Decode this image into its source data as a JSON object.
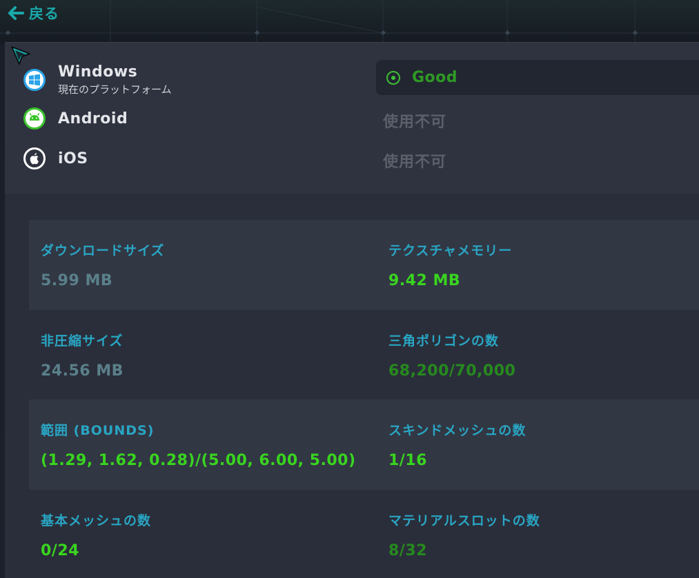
{
  "header": {
    "back_label": "戻る"
  },
  "platforms": [
    {
      "name": "Windows",
      "subtitle": "現在のプラットフォーム",
      "icon": "windows-icon",
      "status": "Good",
      "status_color": "#2f9a25"
    },
    {
      "name": "Android",
      "icon": "android-icon",
      "status": "使用不可"
    },
    {
      "name": "iOS",
      "icon": "apple-icon",
      "status": "使用不可"
    }
  ],
  "colors": {
    "accent": "#1aa9aa",
    "label": "#29a6c4",
    "value_gray": "#5a808a",
    "value_green": "#39d51f",
    "value_dark_green": "#268a1e",
    "unavailable": "#5c606b"
  },
  "stats": {
    "download_size": {
      "label": "ダウンロードサイズ",
      "value": "5.99 MB"
    },
    "texture_memory": {
      "label": "テクスチャメモリー",
      "value": "9.42 MB"
    },
    "uncompressed_size": {
      "label": "非圧縮サイズ",
      "value": "24.56 MB"
    },
    "triangles": {
      "label": "三角ポリゴンの数",
      "value": "68,200/70,000"
    },
    "bounds": {
      "label": "範囲 (BOUNDS)",
      "value": "(1.29, 1.62, 0.28)/(5.00, 6.00, 5.00)"
    },
    "skinned_meshes": {
      "label": "スキンドメッシュの数",
      "value": "1/16"
    },
    "basic_meshes": {
      "label": "基本メッシュの数",
      "value": "0/24"
    },
    "material_slots": {
      "label": "マテリアルスロットの数",
      "value": "8/32"
    }
  }
}
